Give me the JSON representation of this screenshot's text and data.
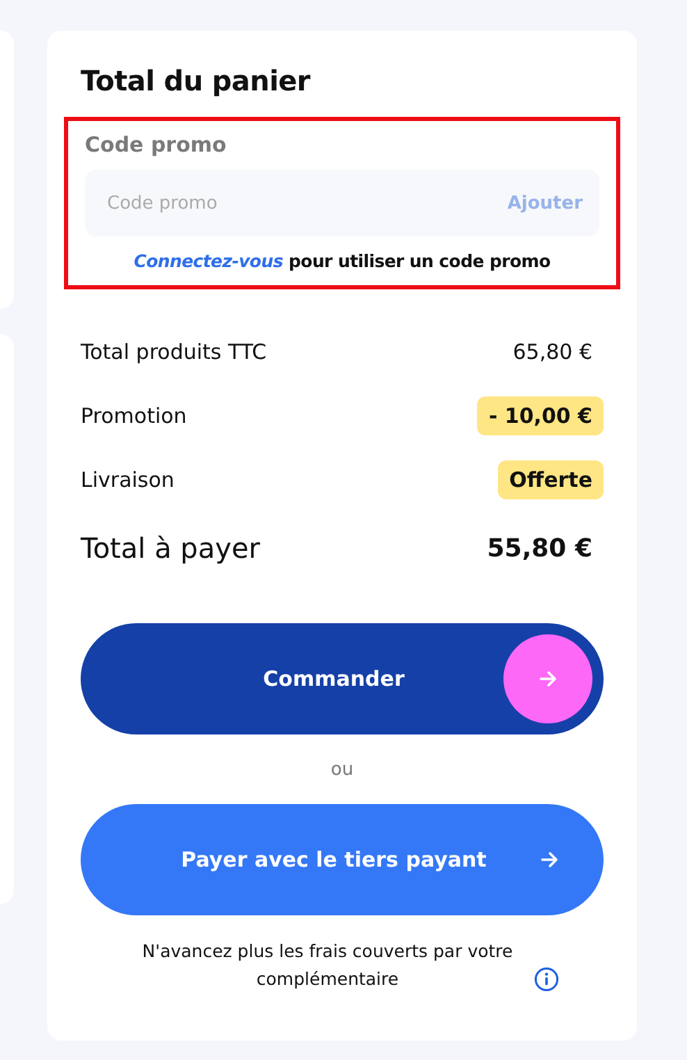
{
  "title": "Total du panier",
  "promo": {
    "highlighted": true,
    "label": "Code promo",
    "placeholder": "Code promo",
    "button": "Ajouter",
    "button_disabled": true,
    "login_link": "Connectez-vous",
    "login_text": "pour utiliser un code promo"
  },
  "summary": [
    {
      "label": "Total produits TTC",
      "value": "65,80 €",
      "highlighted": false
    },
    {
      "label": "Promotion",
      "value": "- 10,00 €",
      "highlighted": true
    },
    {
      "label": "Livraison",
      "value": "Offerte",
      "highlighted": true
    }
  ],
  "total": {
    "label": "Total à payer",
    "value": "55,80 €"
  },
  "order_button": {
    "label": "Commander"
  },
  "separator": "ou",
  "tiers_button": {
    "label": "Payer avec le tiers payant"
  },
  "note": "N'avancez plus les frais couverts par votre complémentaire"
}
